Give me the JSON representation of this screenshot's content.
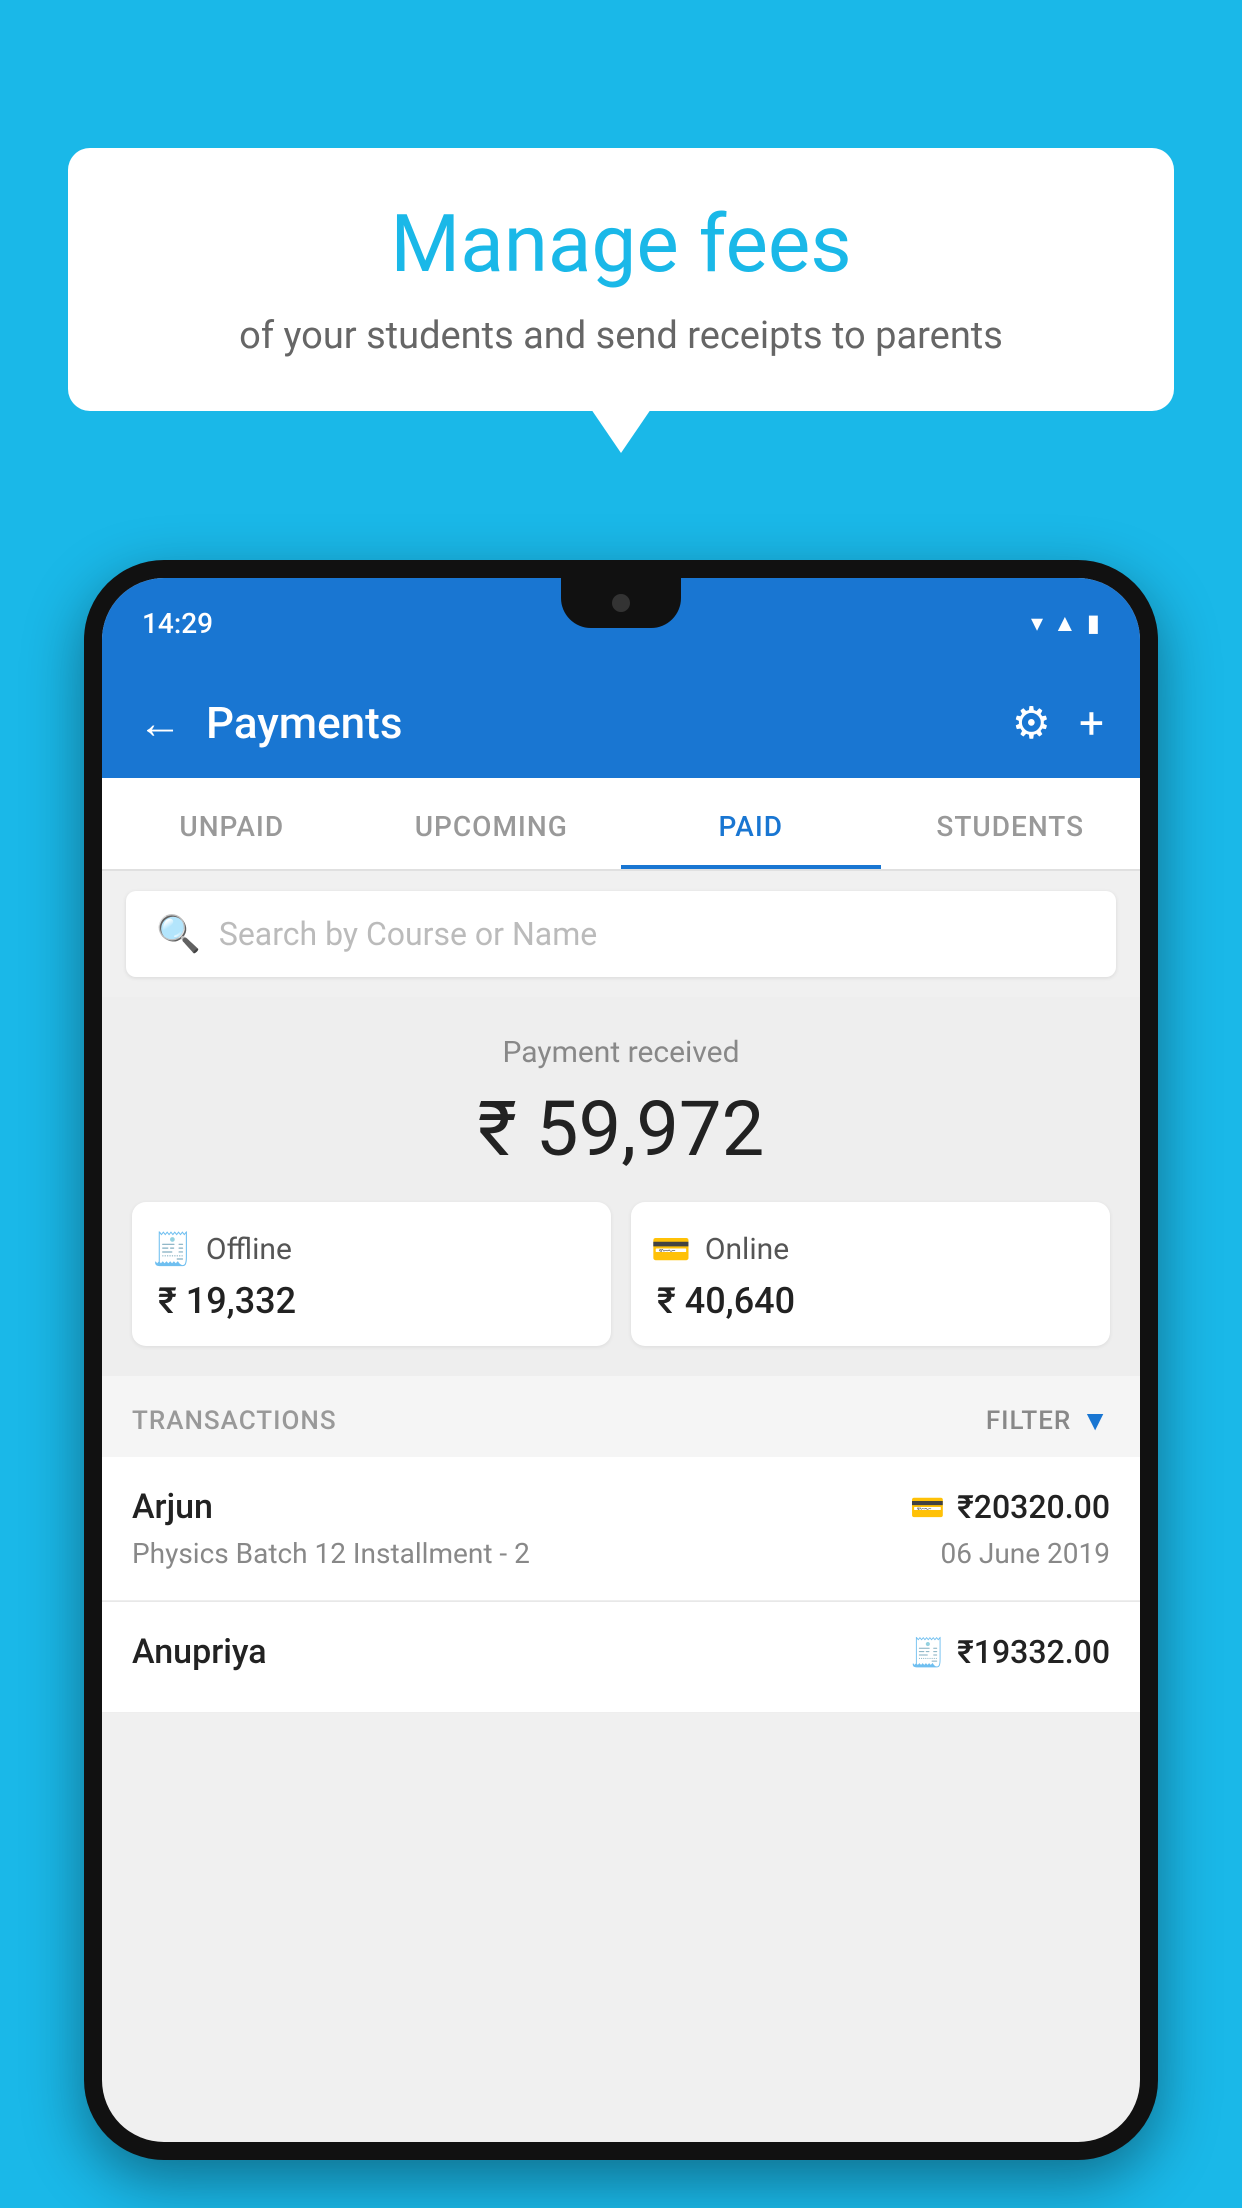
{
  "background_color": "#1ab8e8",
  "bubble": {
    "title": "Manage fees",
    "subtitle": "of your students and send receipts to parents"
  },
  "phone": {
    "status_bar": {
      "time": "14:29",
      "icons": [
        "wifi",
        "signal",
        "battery"
      ]
    },
    "app_bar": {
      "title": "Payments",
      "back_label": "←",
      "settings_label": "⚙",
      "add_label": "+"
    },
    "tabs": [
      {
        "label": "UNPAID",
        "active": false
      },
      {
        "label": "UPCOMING",
        "active": false
      },
      {
        "label": "PAID",
        "active": true
      },
      {
        "label": "STUDENTS",
        "active": false
      }
    ],
    "search": {
      "placeholder": "Search by Course or Name"
    },
    "payment_received": {
      "label": "Payment received",
      "amount": "₹ 59,972",
      "offline": {
        "label": "Offline",
        "amount": "₹ 19,332"
      },
      "online": {
        "label": "Online",
        "amount": "₹ 40,640"
      }
    },
    "transactions": {
      "header_label": "TRANSACTIONS",
      "filter_label": "FILTER",
      "rows": [
        {
          "name": "Arjun",
          "course": "Physics Batch 12 Installment - 2",
          "amount": "₹20320.00",
          "date": "06 June 2019",
          "payment_method": "card"
        },
        {
          "name": "Anupriya",
          "course": "",
          "amount": "₹19332.00",
          "date": "",
          "payment_method": "cash"
        }
      ]
    }
  }
}
